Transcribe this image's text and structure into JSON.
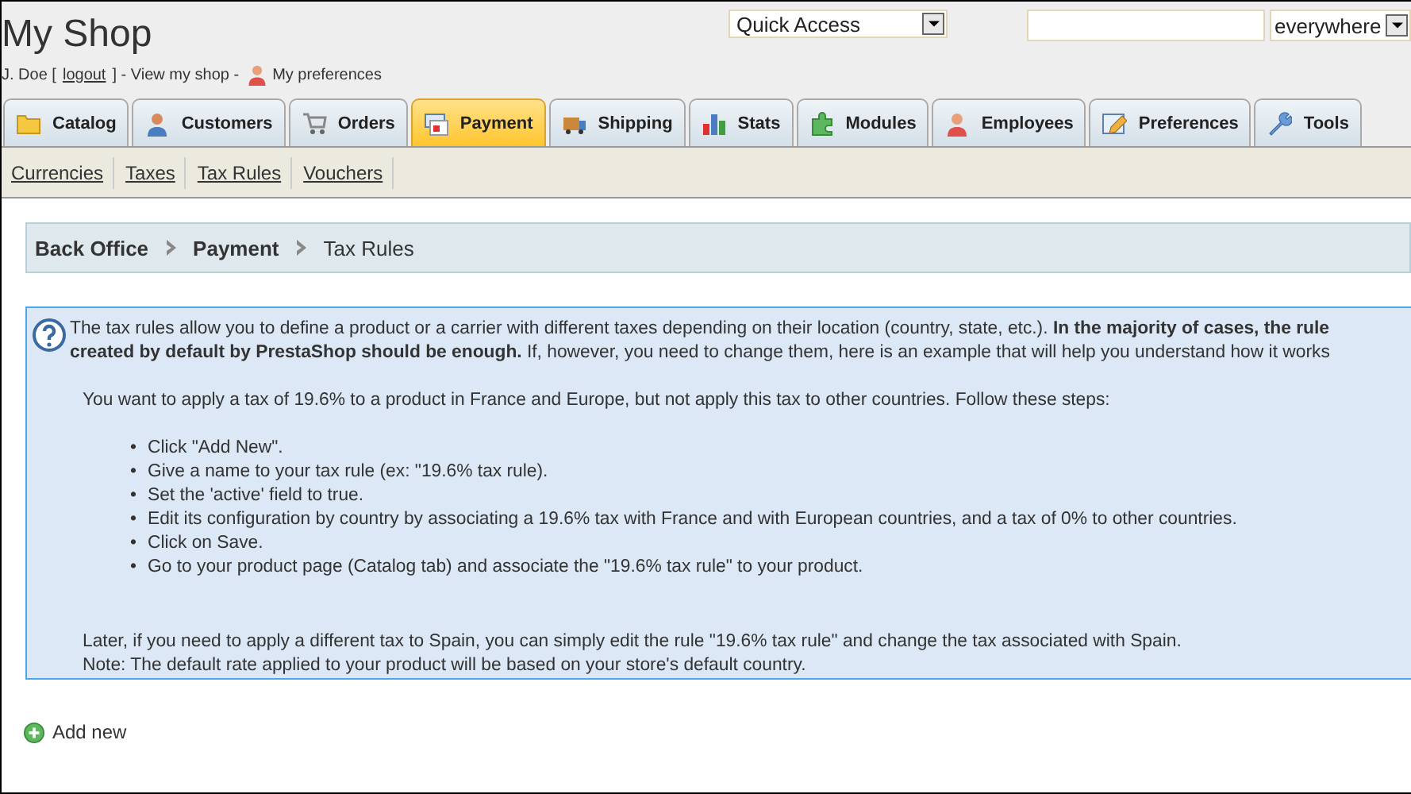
{
  "header": {
    "shop_title": "My Shop",
    "user_bar": [
      {
        "kind": "text",
        "text": "J. Doe ["
      },
      {
        "kind": "link",
        "text": "logout"
      },
      {
        "kind": "text",
        "text": "] - View my shop -"
      },
      {
        "kind": "profile-link",
        "text": "My preferences"
      }
    ],
    "quick_access": {
      "value": "Quick Access"
    },
    "search": {
      "scope": "everywhere"
    }
  },
  "tabs": [
    {
      "label": "Catalog",
      "kind": "folder",
      "selected": false
    },
    {
      "label": "Customers",
      "kind": "person",
      "selected": false
    },
    {
      "label": "Orders",
      "kind": "cart",
      "selected": false
    },
    {
      "label": "Payment",
      "kind": "card",
      "selected": true
    },
    {
      "label": "Shipping",
      "kind": "truck",
      "selected": false
    },
    {
      "label": "Stats",
      "kind": "chart",
      "selected": false
    },
    {
      "label": "Modules",
      "kind": "puzzle",
      "selected": false
    },
    {
      "label": "Employees",
      "kind": "person-red",
      "selected": false
    },
    {
      "label": "Preferences",
      "kind": "pencil",
      "selected": false
    },
    {
      "label": "Tools",
      "kind": "wrench",
      "selected": false
    }
  ],
  "subtabs": [
    {
      "label": "Currencies",
      "selected": false
    },
    {
      "label": "Taxes",
      "selected": false
    },
    {
      "label": "Tax Rules",
      "selected": false
    },
    {
      "label": "Vouchers",
      "selected": false
    }
  ],
  "breadcrumb": [
    "Back Office",
    "Payment",
    "Tax Rules"
  ],
  "info": {
    "intro_lines": [
      "The tax rules allow you to define a product or a carrier with different taxes depending on their location (country, state, etc.). **In the majority of cases, the rule**",
      "**created by default by PrestaShop should be enough.** If, however, you need to change them, here is an example that will help you understand how it works"
    ],
    "lead": "You want to apply a tax of 19.6% to a product in France and Europe, but not apply this tax to other countries. Follow these steps:",
    "steps": [
      {
        "bullet": "•",
        "text": "Click \"Add New\"."
      },
      {
        "bullet": "•",
        "text": "Give a name to your tax rule (ex: \"19.6% tax rule)."
      },
      {
        "bullet": "•",
        "text": "Set the 'active' field to true."
      },
      {
        "bullet": "•",
        "text": "Edit its configuration by country by associating a 19.6% tax with France and with European countries, and a tax of 0% to other countries."
      },
      {
        "bullet": "•",
        "text": "Click on Save."
      },
      {
        "bullet": "•",
        "text": "Go to your product page (Catalog tab) and associate the \"19.6% tax rule\" to your product."
      }
    ],
    "notes": [
      "Later, if you need to apply a different tax to Spain, you can simply edit the rule \"19.6% tax rule\" and change the tax associated with Spain.",
      "Note: The default rate applied to your product will be based on your store's default country."
    ]
  },
  "add_new": "Add new"
}
